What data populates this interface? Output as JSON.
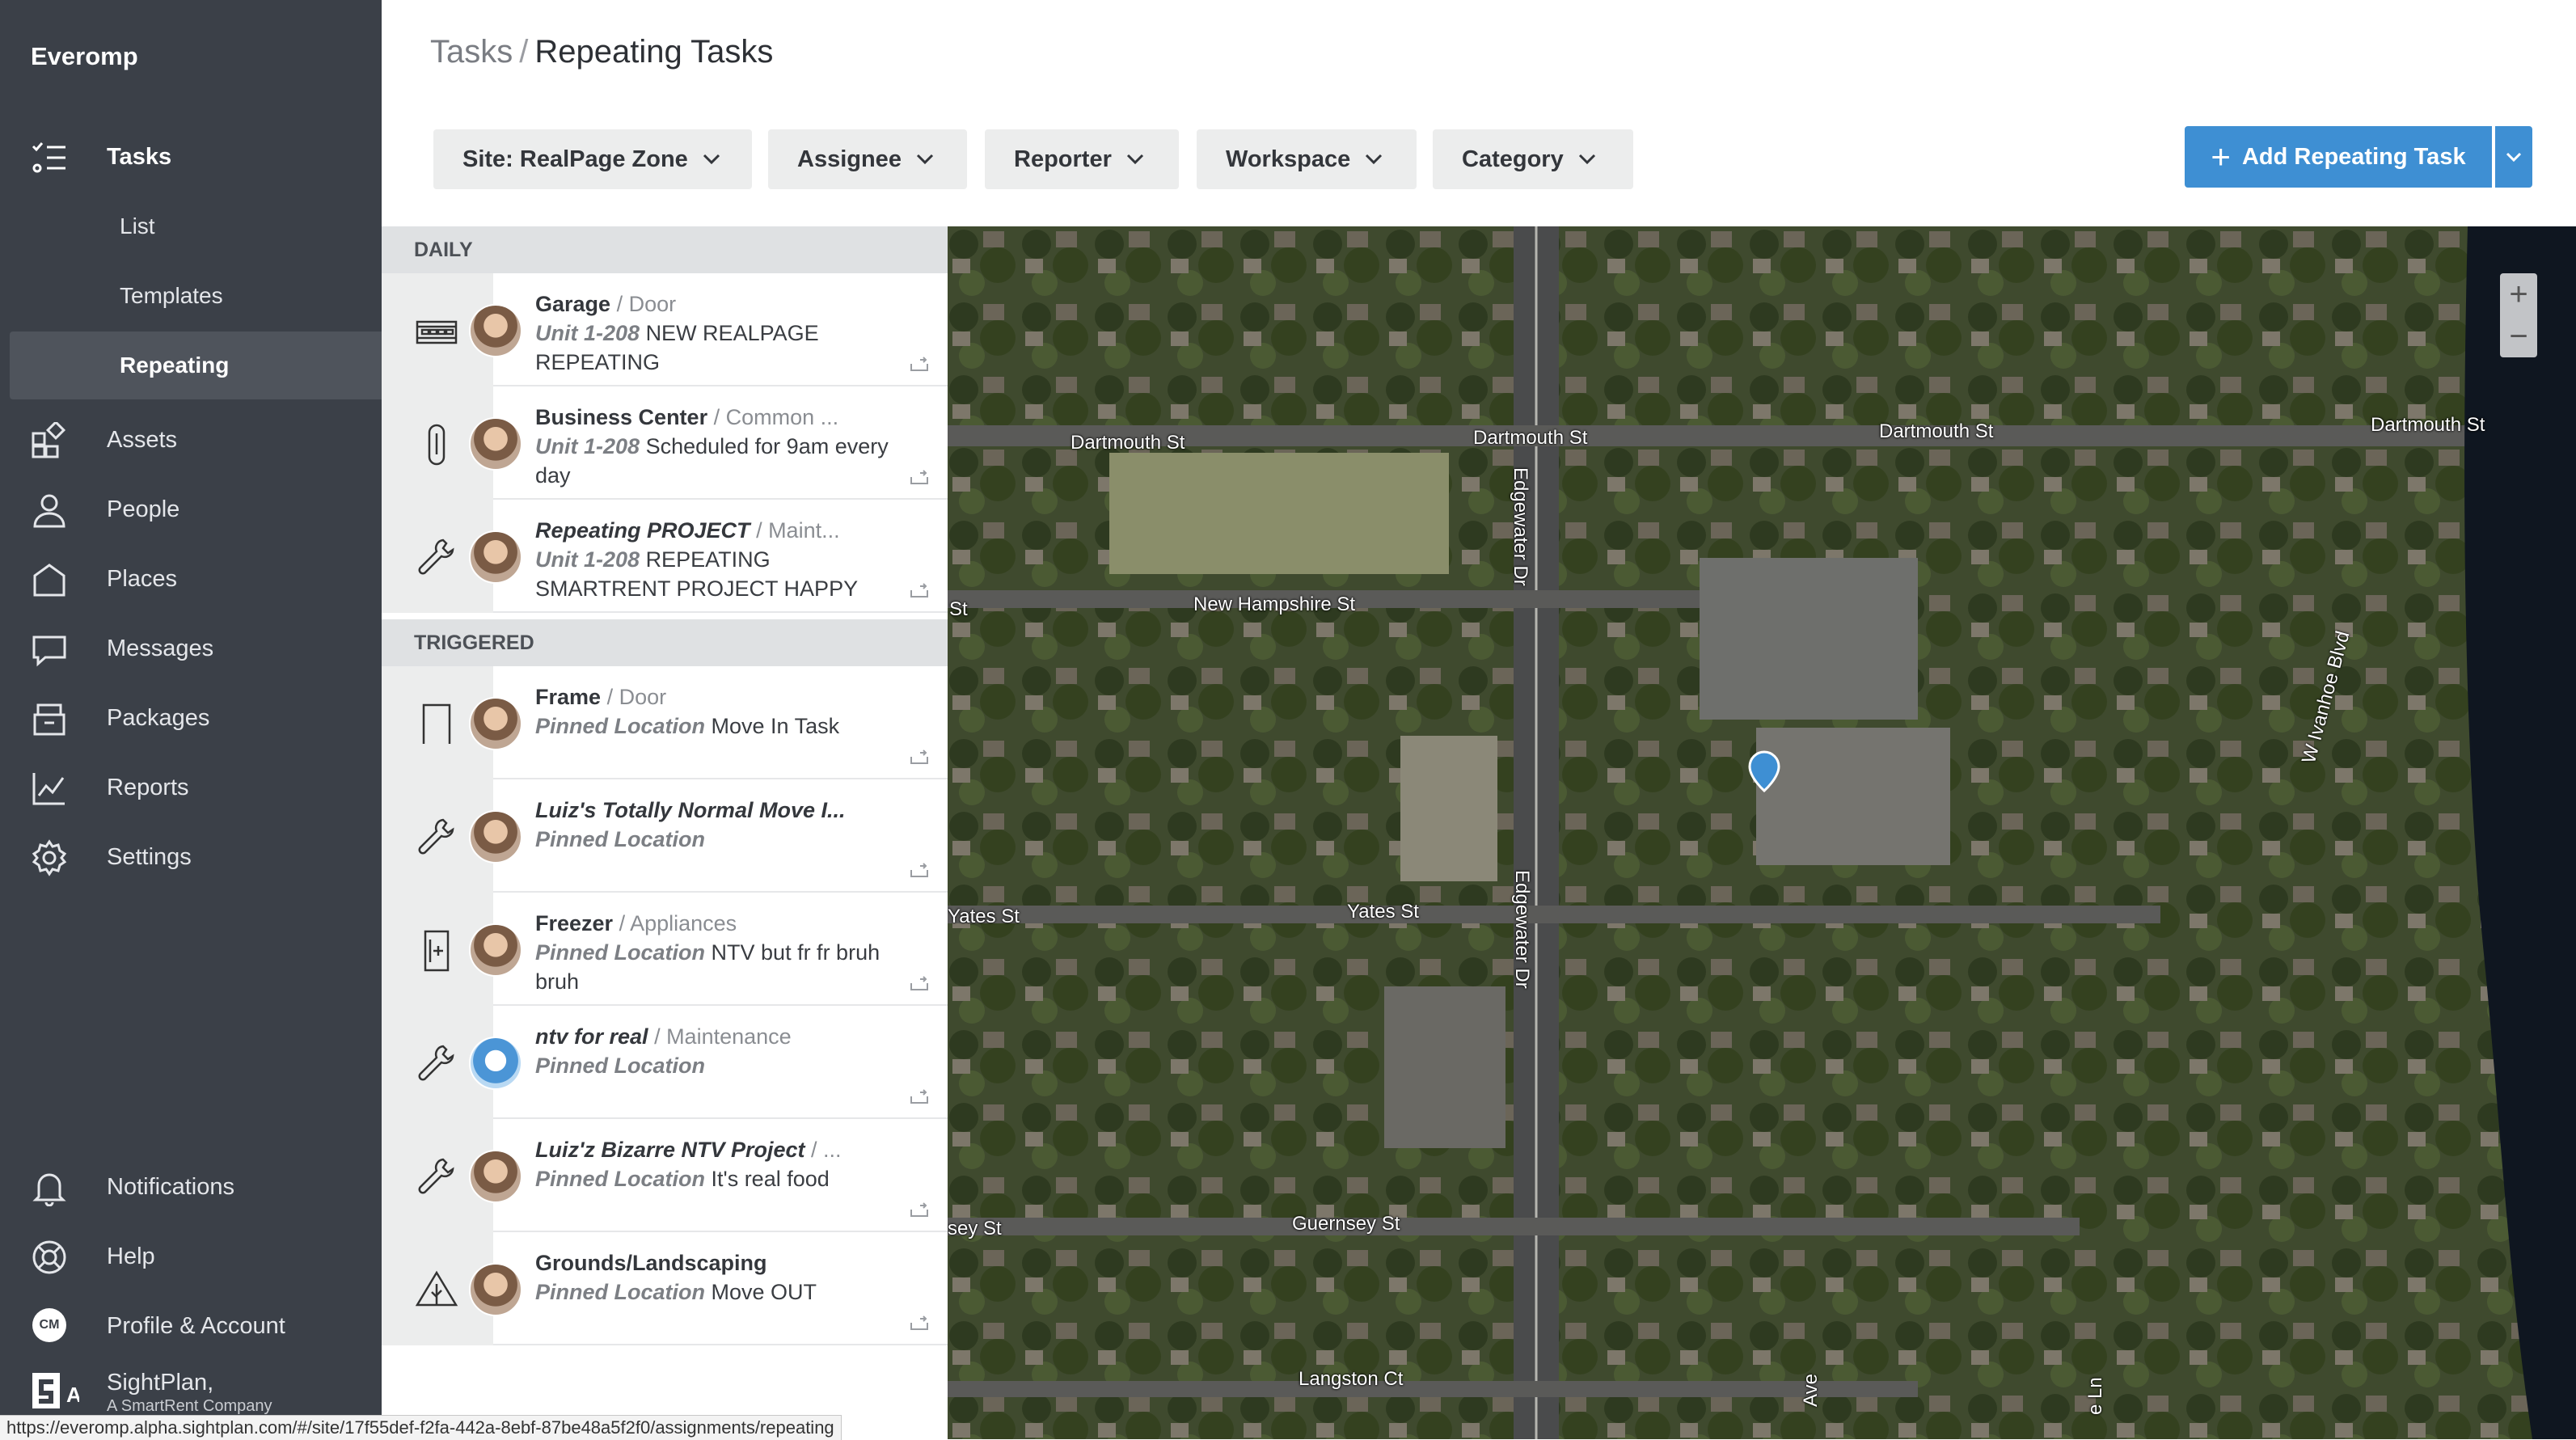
{
  "app": {
    "brand": "Everomp"
  },
  "sidebar": {
    "tasks": "Tasks",
    "sub": {
      "list": "List",
      "templates": "Templates",
      "repeating": "Repeating"
    },
    "items": [
      "Assets",
      "People",
      "Places",
      "Messages",
      "Packages",
      "Reports",
      "Settings"
    ],
    "bottom": {
      "notifications": "Notifications",
      "help": "Help",
      "profile": "Profile & Account",
      "profile_initials": "CM"
    },
    "company": {
      "name": "SightPlan,",
      "sub": "A SmartRent Company"
    }
  },
  "header": {
    "breadcrumb_root": "Tasks",
    "breadcrumb_sep": "/",
    "title": "Repeating Tasks"
  },
  "filters": {
    "site": "Site: RealPage Zone",
    "assignee": "Assignee",
    "reporter": "Reporter",
    "workspace": "Workspace",
    "category": "Category"
  },
  "actions": {
    "add": "Add Repeating Task"
  },
  "list": {
    "daily_label": "DAILY",
    "triggered_label": "TRIGGERED",
    "daily": [
      {
        "title": "Garage",
        "category": "/ Door",
        "location": "Unit 1-208",
        "desc": "NEW REALPAGE REPEATING",
        "icon": "garage-icon"
      },
      {
        "title": "Business Center",
        "category": "/ Common ...",
        "location": "Unit 1-208",
        "desc": "Scheduled for 9am every day",
        "icon": "paperclip-icon"
      },
      {
        "title": "Repeating PROJECT",
        "category": "/ Maint...",
        "location": "Unit 1-208",
        "desc": "REPEATING SMARTRENT PROJECT HAPPY",
        "icon": "wrench-icon"
      }
    ],
    "triggered": [
      {
        "title": "Frame",
        "category": "/ Door",
        "location": "Pinned Location",
        "desc": "Move In Task",
        "icon": "door-icon"
      },
      {
        "title": "Luiz's Totally Normal Move I...",
        "category": "",
        "location": "Pinned Location",
        "desc": "",
        "icon": "wrench-icon"
      },
      {
        "title": "Freezer",
        "category": "/ Appliances",
        "location": "Pinned Location",
        "desc": "NTV but fr fr bruh bruh",
        "icon": "freezer-icon"
      },
      {
        "title": "ntv for real",
        "category": "/ Maintenance",
        "location": "Pinned Location",
        "desc": "",
        "icon": "wrench-icon"
      },
      {
        "title": "Luiz'z Bizarre NTV Project",
        "category": "/ ...",
        "location": "Pinned Location",
        "desc": "It's real food",
        "icon": "wrench-icon"
      },
      {
        "title": "Grounds/Landscaping",
        "category": "",
        "location": "Pinned Location",
        "desc": "Move OUT",
        "icon": "landscape-icon"
      }
    ]
  },
  "map": {
    "streets": [
      "Dartmouth St",
      "Dartmouth St",
      "Dartmouth St",
      "Dartmouth St",
      "Edgewater Dr",
      "New Hampshire St",
      "St",
      "Yates St",
      "Yates St",
      "Edgewater Dr",
      "W Ivanhoe Blvd",
      "Guernsey St",
      "sey St",
      "Langston Ct",
      "Ave",
      "e Ln"
    ],
    "zoom_in": "+",
    "zoom_out": "−"
  },
  "status": {
    "url": "https://everomp.alpha.sightplan.com/#/site/17f55def-f2fa-442a-8ebf-87be48a5f2f0/assignments/repeating"
  }
}
